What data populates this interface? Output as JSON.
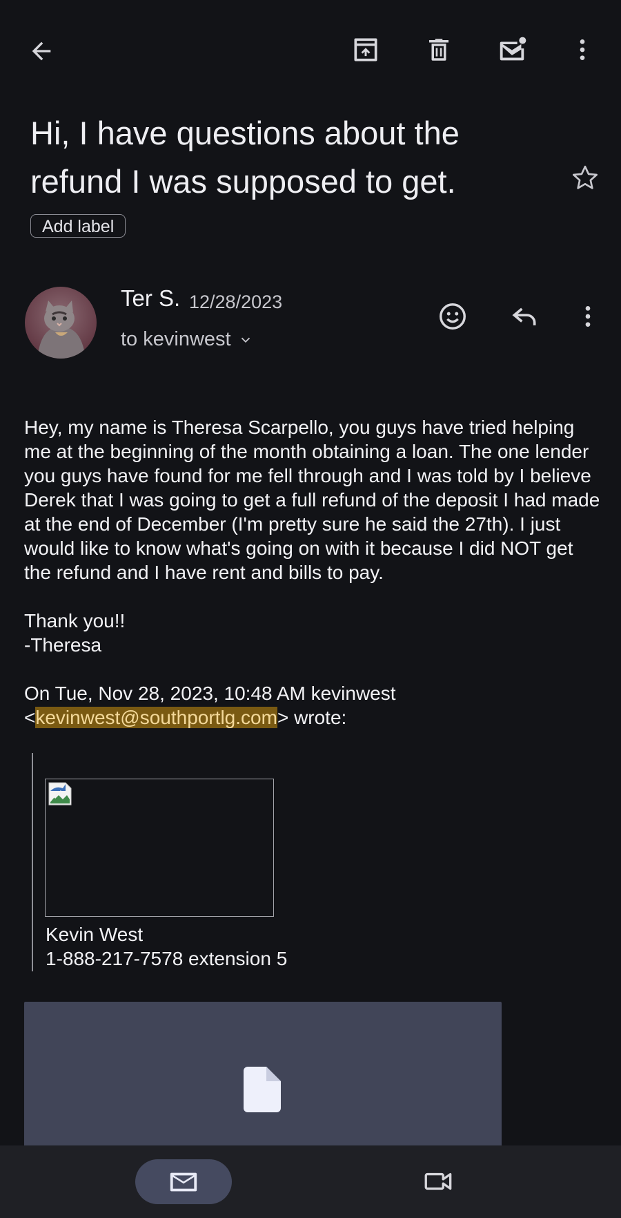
{
  "toolbar": {
    "back_icon": "arrow-left-icon",
    "archive_icon": "archive-icon",
    "delete_icon": "trash-icon",
    "mark_unread_icon": "mail-unread-icon",
    "more_icon": "more-vert-icon"
  },
  "email": {
    "subject": "Hi, I have questions about the refund I was supposed to get.",
    "add_label": "Add label",
    "sender_name": "Ter S.",
    "date": "12/28/2023",
    "recipient": "to kevinwest",
    "body_paragraph": "Hey, my name is Theresa Scarpello, you guys have tried helping me at the beginning of the month obtaining a loan. The one lender you guys have found for me fell through and I was told by I believe Derek that I was going to get a full refund of the deposit I had made at the end of December (I'm pretty sure he said the 27th). I just would like to know what's going on with it because I did NOT get the refund and I have rent and bills to pay.",
    "thanks": "Thank you!!",
    "signoff": "-Theresa",
    "quote_header_prefix": "On Tue, Nov 28, 2023, 10:48 AM kevinwest",
    "quote_email_open": "<",
    "quote_email": "kevinwest@southportlg.com",
    "quote_email_close": "> wrote:",
    "signature_name": "Kevin West",
    "signature_phone": "1-888-217-7578 extension 5"
  },
  "colors": {
    "background": "#121317",
    "highlight": "#7a5a12",
    "attachment": "#414558",
    "bottom_nav": "#1f2025",
    "nav_active": "#454a60"
  },
  "bottom_nav": {
    "mail_icon": "mail-icon",
    "meet_icon": "video-camera-icon"
  }
}
